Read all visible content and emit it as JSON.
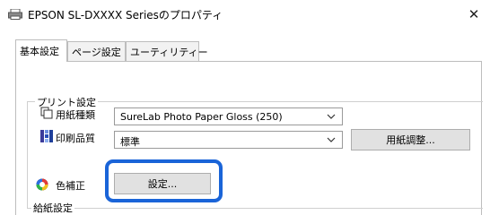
{
  "window": {
    "title": "EPSON SL-DXXXX Seriesのプロパティ",
    "close_glyph": "✕"
  },
  "tabs": [
    {
      "label": "基本設定"
    },
    {
      "label": "ページ設定"
    },
    {
      "label": "ユーティリティー"
    }
  ],
  "print_settings": {
    "group_label": "プリント設定",
    "paper_type": {
      "label": "用紙種類",
      "value": "SureLab Photo Paper Gloss (250)",
      "icon": "paper-type-icon"
    },
    "print_quality": {
      "label": "印刷品質",
      "value": "標準",
      "icon": "quality-icon",
      "adjust_button": "用紙調整..."
    },
    "color_correction": {
      "label": "色補正",
      "icon": "color-wheel-icon",
      "settings_button": "設定..."
    }
  },
  "paper_source": {
    "group_label": "給紙設定"
  },
  "colors": {
    "highlight": "#1a64d8"
  }
}
